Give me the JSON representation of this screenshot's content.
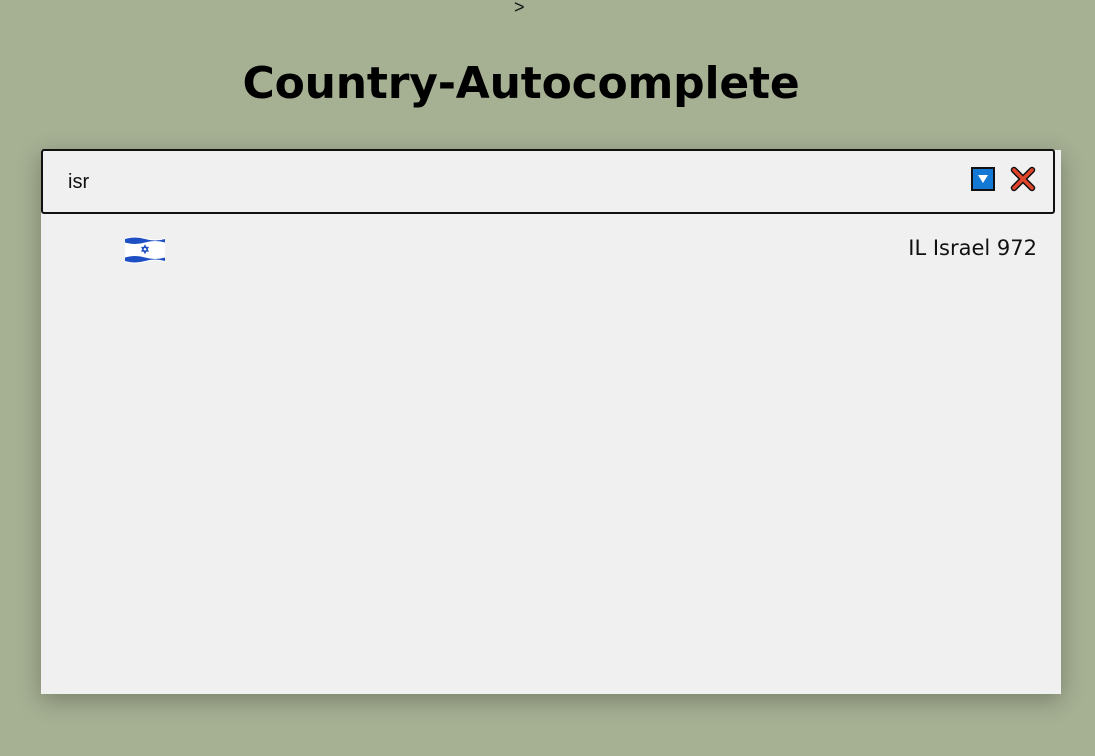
{
  "page": {
    "stray_text": ">",
    "title": "Country-Autocomplete"
  },
  "search": {
    "value": "isr",
    "dropdown_icon": "chevron-down-icon",
    "clear_icon": "close-icon",
    "accent_color": "#1479d4",
    "clear_color": "#e0442b"
  },
  "results": [
    {
      "flag_icon": "israel-flag-icon",
      "code": "IL",
      "name": "Israel",
      "dial_code": "972",
      "label": "IL Israel 972"
    }
  ]
}
